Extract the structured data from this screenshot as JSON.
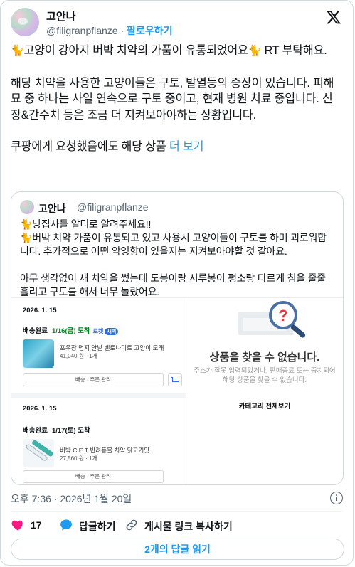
{
  "author": {
    "display_name": "고안나",
    "handle": "@filigranpflanze",
    "follow_label": "팔로우하기",
    "separator": "·"
  },
  "tweet": {
    "line1": "고양이 강아지 버박 치약의 가품이 유통되었어요",
    "line1_tail": " RT 부탁해요.",
    "para2": "해당 치약을 사용한 고양이들은 구토, 발열등의 증상이 있습니다. 피해묘 중 하나는 사일 연속으로 구토 중이고, 현재 병원 치료 중입니다. 신장&간수치 등은 조금 더 지켜보아야하는 상황입니다.",
    "para3": "쿠팡에게 요청했음에도 해당 상품 ",
    "more_label": "더 보기",
    "emoji_icon": "cat-emoji-icon"
  },
  "quote": {
    "display_name": "고안나",
    "handle": "@filigranpflanze",
    "line1": "냥집사들 알티로 알려주세요!!",
    "line2": "버박 치약 가품이 유통되고 있고 사용시 고양이들이 구토를 하며 괴로워합니다. 추가적으로 어떤 악영향이 있을지는 지켜보아야할 것 같아요.",
    "line3": "아무 생각없이 새 치약을 썼는데 도봉이랑 시루봉이 평소랑 다르게 침을 줄줄 흘리고 구토를 해서 너무 놀랐어요."
  },
  "orders": [
    {
      "date": "2026. 1. 15",
      "status": "배송완료",
      "delivery": "1/16(금) 도착",
      "rocket": "로켓",
      "rocket_badge": "새벽",
      "product": "포우장 먼지 안날 벤토나이트 고양이 모래",
      "price": "41,040 원 · 1개",
      "manage": "배송 · 주문 관리"
    },
    {
      "date": "2026. 1. 15",
      "status": "배송완료",
      "delivery": "1/17(토) 도착",
      "product": "버박 C.E.T 반려동물 치약 닭고기맛",
      "price": "27,560 원 · 1개",
      "manage": "배송 · 주문 관리"
    }
  ],
  "not_found": {
    "title": "상품을 찾을 수 없습니다.",
    "desc1": "주소가 잘못 입력되었거나, 판매종료 또는 중지되어",
    "desc2": "해당 상품을 찾을 수 없습니다.",
    "link": "카테고리 전체보기"
  },
  "meta": {
    "timestamp": "오후 7:36 · 2026년 1월 20일"
  },
  "actions": {
    "like_count": "17",
    "reply_label": "답글하기",
    "copy_link_label": "게시물 링크 복사하기",
    "read_replies_label": "2개의 답글 읽기"
  },
  "colors": {
    "accent": "#1d9bf0",
    "like": "#f91880",
    "text": "#0f1419",
    "muted": "#536471",
    "border": "#cfd9de"
  }
}
